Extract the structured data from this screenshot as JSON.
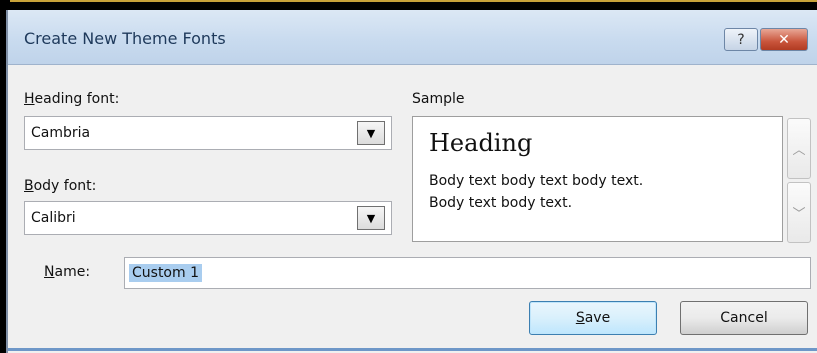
{
  "dialog": {
    "title": "Create New Theme Fonts",
    "help_label": "?",
    "close_label": "✕"
  },
  "heading_font": {
    "label_mnemonic": "H",
    "label_rest": "eading font:",
    "value": "Cambria"
  },
  "body_font": {
    "label_mnemonic": "B",
    "label_rest": "ody font:",
    "value": "Calibri"
  },
  "sample": {
    "label": "Sample",
    "heading": "Heading",
    "body_line_1": "Body text body text body text.",
    "body_line_2": "Body text body text."
  },
  "name": {
    "label_mnemonic": "N",
    "label_rest": "ame:",
    "value": "Custom 1"
  },
  "buttons": {
    "save_mnemonic": "S",
    "save_rest": "ave",
    "cancel": "Cancel"
  },
  "icons": {
    "dropdown": "▼",
    "scroll_up": "︿",
    "scroll_down": "﹀"
  },
  "colors": {
    "selection": "#a9cdef",
    "titlebar": "#c9dbef",
    "close_button": "#c9553c",
    "default_button_border": "#3c7fb1"
  }
}
